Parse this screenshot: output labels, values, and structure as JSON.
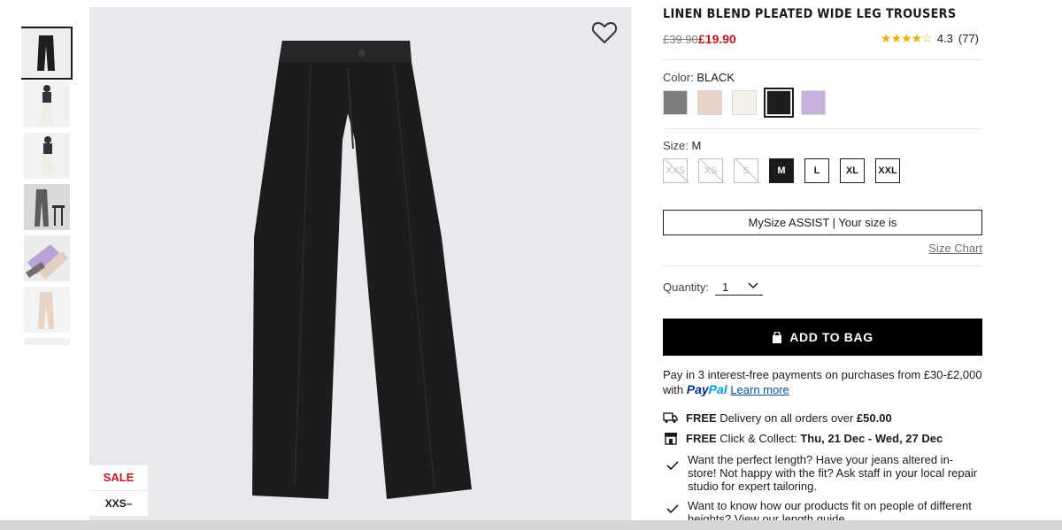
{
  "product": {
    "title": "LINEN BLEND PLEATED WIDE LEG TROUSERS",
    "price_original": "£39.90",
    "price_sale": "£19.90",
    "rating_value": "4.3",
    "rating_count": "(77)",
    "stars": "★★★★☆"
  },
  "badges": {
    "sale": "SALE",
    "size_range": "XXS–XXL"
  },
  "color": {
    "label": "Color:",
    "selected": "BLACK",
    "swatches": [
      {
        "name": "grey",
        "hex": "#7b7d7a"
      },
      {
        "name": "beige",
        "hex": "#e6d2c6"
      },
      {
        "name": "off-white",
        "hex": "#f4f1ea"
      },
      {
        "name": "black",
        "hex": "#1e1e1e"
      },
      {
        "name": "purple",
        "hex": "#c6b1de"
      }
    ]
  },
  "size": {
    "label": "Size:",
    "selected": "M",
    "options": [
      "XXS",
      "XS",
      "S",
      "M",
      "L",
      "XL",
      "XXL"
    ]
  },
  "mysize": {
    "label": "MySize ASSIST | Your size is"
  },
  "size_chart": "Size Chart",
  "quantity": {
    "label": "Quantity:",
    "value": "1"
  },
  "add_to_bag": "ADD TO BAG",
  "paypal": {
    "text": "Pay in 3 interest-free payments on purchases from £30-£2,000",
    "with": "with",
    "brand_a": "Pay",
    "brand_b": "Pal",
    "learn_more": "Learn more"
  },
  "delivery": {
    "free": "FREE",
    "text": "Delivery on all orders over",
    "amount": "£50.00"
  },
  "collect": {
    "free": "FREE",
    "text": "Click & Collect:",
    "dates": "Thu, 21 Dec - Wed, 27 Dec"
  },
  "benefits": [
    "Want the perfect length? Have your jeans altered in-store! Not happy with the fit? Ask staff in your local repair studio for expert tailoring.",
    "Want to know how our products fit on people of different heights? View our length guide"
  ]
}
